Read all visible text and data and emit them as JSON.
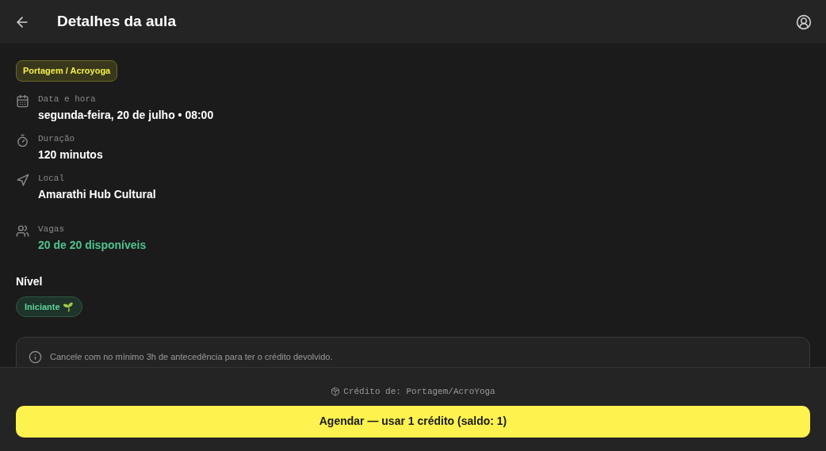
{
  "header": {
    "title": "Detalhes da aula"
  },
  "tag": "Portagem / Acroyoga",
  "details": [
    {
      "kind": "date",
      "label": "Data e hora",
      "value": "segunda-feira, 20 de julho • 08:00"
    },
    {
      "kind": "duration",
      "label": "Duração",
      "value": "120 minutos"
    },
    {
      "kind": "location",
      "label": "Local",
      "value": "Amarathi Hub Cultural"
    },
    {
      "kind": "seats",
      "label": "Vagas",
      "value": "20 de 20 disponíveis"
    }
  ],
  "level": {
    "heading": "Nível",
    "badge": "Iniciante 🌱"
  },
  "notice": "Cancele com no mínimo 3h de antecedência para ter o crédito devolvido.",
  "footer": {
    "credit": "Crédito de: Portagem/AcroYoga",
    "button": "Agendar — usar 1 crédito (saldo: 1)"
  }
}
